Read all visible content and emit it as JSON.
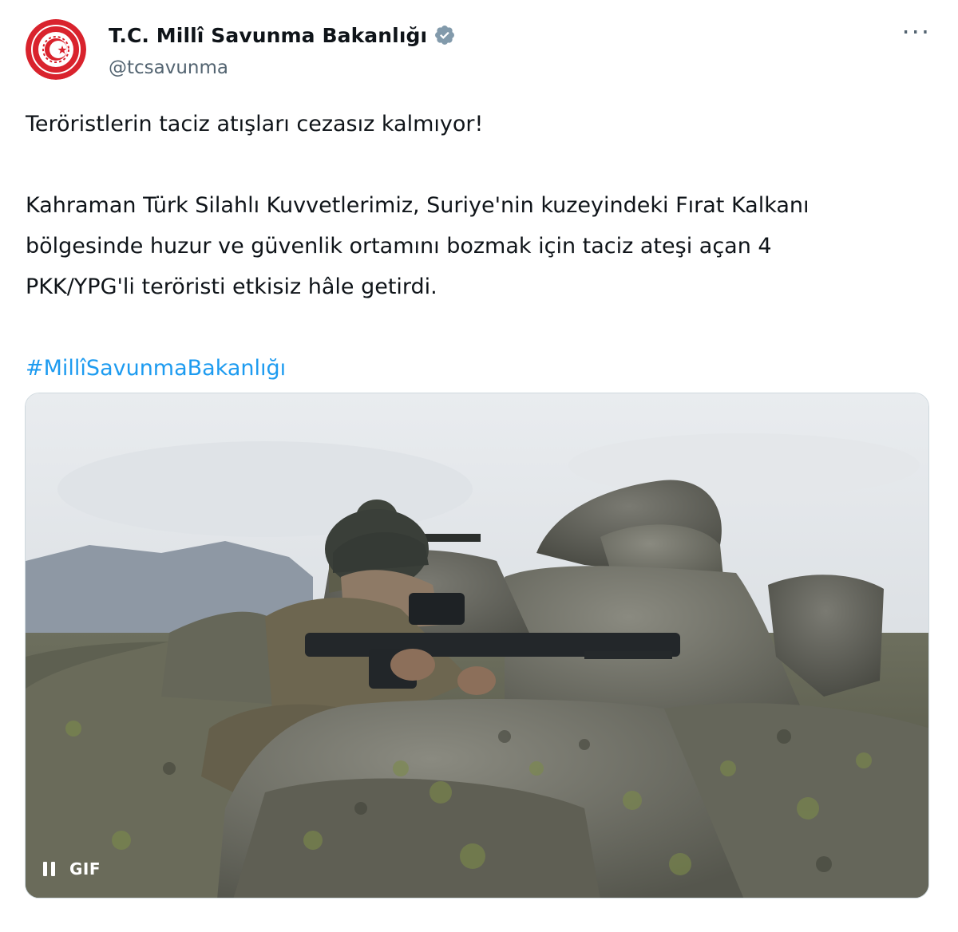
{
  "tweet": {
    "display_name": "T.C. Millî Savunma Bakanlığı",
    "handle": "@tcsavunma",
    "more_label": "···",
    "lines": [
      "Teröristlerin taciz atışları cezasız kalmıyor!",
      "Kahraman Türk Silahlı Kuvvetlerimiz, Suriye'nin kuzeyindeki Fırat Kalkanı",
      "bölgesinde huzur ve güvenlik ortamını bozmak için taciz ateşi açan 4",
      "PKK/YPG'li teröristi etkisiz hâle getirdi."
    ],
    "hashtag": "#MillîSavunmaBakanlığı",
    "media": {
      "badge": "GIF",
      "pause_icon": "pause-icon"
    },
    "colors": {
      "link": "#1d9bf0",
      "verified": "#829aab",
      "secondary": "#536471",
      "logo_red": "#d9232d"
    },
    "icons": {
      "avatar": "ministry-emblem-icon",
      "verified": "verified-badge-icon",
      "more": "more-options-icon"
    }
  }
}
